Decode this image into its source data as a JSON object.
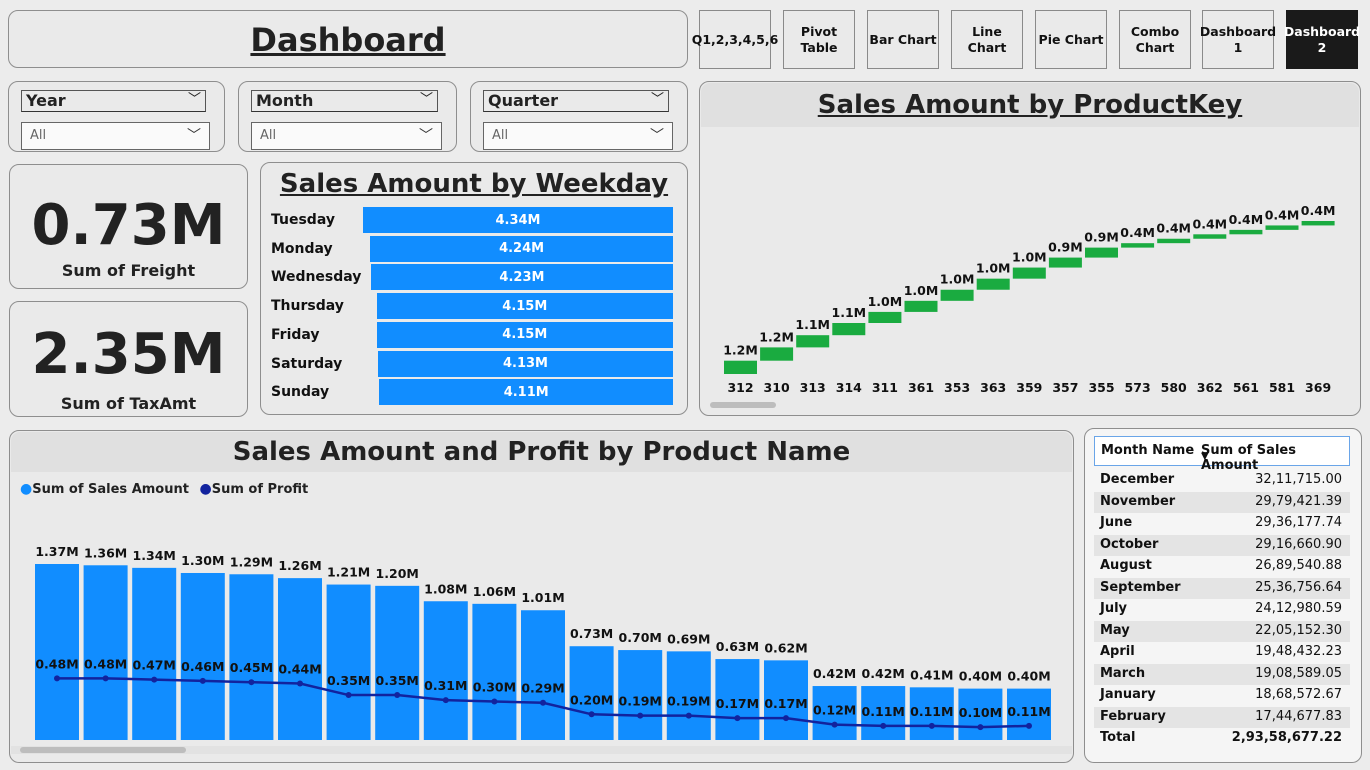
{
  "header": {
    "title": "Dashboard"
  },
  "nav": [
    {
      "label": "Q1,2,3,4,5,6",
      "active": false
    },
    {
      "label": "Pivot Table",
      "active": false
    },
    {
      "label": "Bar Chart",
      "active": false
    },
    {
      "label": "Line Chart",
      "active": false
    },
    {
      "label": "Pie Chart",
      "active": false
    },
    {
      "label": "Combo Chart",
      "active": false
    },
    {
      "label": "Dashboard 1",
      "active": false
    },
    {
      "label": "Dashboard 2",
      "active": true
    }
  ],
  "slicers": [
    {
      "label": "Year",
      "value": "All"
    },
    {
      "label": "Month",
      "value": "All"
    },
    {
      "label": "Quarter",
      "value": "All"
    }
  ],
  "kpis": {
    "freight": {
      "value": "0.73M",
      "label": "Sum of Freight"
    },
    "tax": {
      "value": "2.35M",
      "label": "Sum of TaxAmt"
    }
  },
  "colors": {
    "accent": "#118dff",
    "profit": "#12239e",
    "waterfall": "#1aab40",
    "active_nav": "#1a1a1a"
  },
  "chart_data": [
    {
      "type": "bar",
      "title": "Sales Amount by Weekday",
      "orientation": "horizontal",
      "categories": [
        "Tuesday",
        "Monday",
        "Wednesday",
        "Thursday",
        "Friday",
        "Saturday",
        "Sunday"
      ],
      "values": [
        4.34,
        4.24,
        4.23,
        4.15,
        4.15,
        4.13,
        4.11
      ],
      "labels": [
        "4.34M",
        "4.24M",
        "4.23M",
        "4.15M",
        "4.15M",
        "4.13M",
        "4.11M"
      ]
    },
    {
      "type": "bar",
      "subtype": "waterfall",
      "title": "Sales Amount by ProductKey",
      "categories": [
        "312",
        "310",
        "313",
        "314",
        "311",
        "361",
        "353",
        "363",
        "359",
        "357",
        "355",
        "573",
        "580",
        "362",
        "561",
        "581",
        "369"
      ],
      "values": [
        1.2,
        1.2,
        1.1,
        1.1,
        1.0,
        1.0,
        1.0,
        1.0,
        1.0,
        0.9,
        0.9,
        0.4,
        0.4,
        0.4,
        0.4,
        0.4,
        0.4
      ],
      "labels": [
        "1.2M",
        "1.2M",
        "1.1M",
        "1.1M",
        "1.0M",
        "1.0M",
        "1.0M",
        "1.0M",
        "1.0M",
        "0.9M",
        "0.9M",
        "0.4M",
        "0.4M",
        "0.4M",
        "0.4M",
        "0.4M",
        "0.4M"
      ]
    },
    {
      "type": "bar",
      "subtype": "combo",
      "title": "Sales Amount and Profit by Product Name",
      "legend": [
        "Sum of Sales Amount",
        "Sum of Profit"
      ],
      "series": [
        {
          "name": "Sum of Sales Amount",
          "type": "bar",
          "values": [
            1.37,
            1.36,
            1.34,
            1.3,
            1.29,
            1.26,
            1.21,
            1.2,
            1.08,
            1.06,
            1.01,
            0.73,
            0.7,
            0.69,
            0.63,
            0.62,
            0.42,
            0.42,
            0.41,
            0.4,
            0.4
          ],
          "labels": [
            "1.37M",
            "1.36M",
            "1.34M",
            "1.30M",
            "1.29M",
            "1.26M",
            "1.21M",
            "1.20M",
            "1.08M",
            "1.06M",
            "1.01M",
            "0.73M",
            "0.70M",
            "0.69M",
            "0.63M",
            "0.62M",
            "0.42M",
            "0.42M",
            "0.41M",
            "0.40M",
            "0.40M"
          ]
        },
        {
          "name": "Sum of Profit",
          "type": "line",
          "values": [
            0.48,
            0.48,
            0.47,
            0.46,
            0.45,
            0.44,
            0.35,
            0.35,
            0.31,
            0.3,
            0.29,
            0.2,
            0.19,
            0.19,
            0.17,
            0.17,
            0.12,
            0.11,
            0.11,
            0.1,
            0.11
          ],
          "labels": [
            "0.48M",
            "0.48M",
            "0.47M",
            "0.46M",
            "0.45M",
            "0.44M",
            "0.35M",
            "0.35M",
            "0.31M",
            "0.30M",
            "0.29M",
            "0.20M",
            "0.19M",
            "0.19M",
            "0.17M",
            "0.17M",
            "0.12M",
            "0.11M",
            "0.11M",
            "0.10M",
            "0.11M"
          ]
        }
      ]
    },
    {
      "type": "table",
      "columns": [
        "Month Name",
        "Sum of Sales Amount"
      ],
      "rows": [
        [
          "December",
          "32,11,715.00"
        ],
        [
          "November",
          "29,79,421.39"
        ],
        [
          "June",
          "29,36,177.74"
        ],
        [
          "October",
          "29,16,660.90"
        ],
        [
          "August",
          "26,89,540.88"
        ],
        [
          "September",
          "25,36,756.64"
        ],
        [
          "July",
          "24,12,980.59"
        ],
        [
          "May",
          "22,05,152.30"
        ],
        [
          "April",
          "19,48,432.23"
        ],
        [
          "March",
          "19,08,589.05"
        ],
        [
          "January",
          "18,68,572.67"
        ],
        [
          "February",
          "17,44,677.83"
        ]
      ],
      "total": [
        "Total",
        "2,93,58,677.22"
      ]
    }
  ]
}
